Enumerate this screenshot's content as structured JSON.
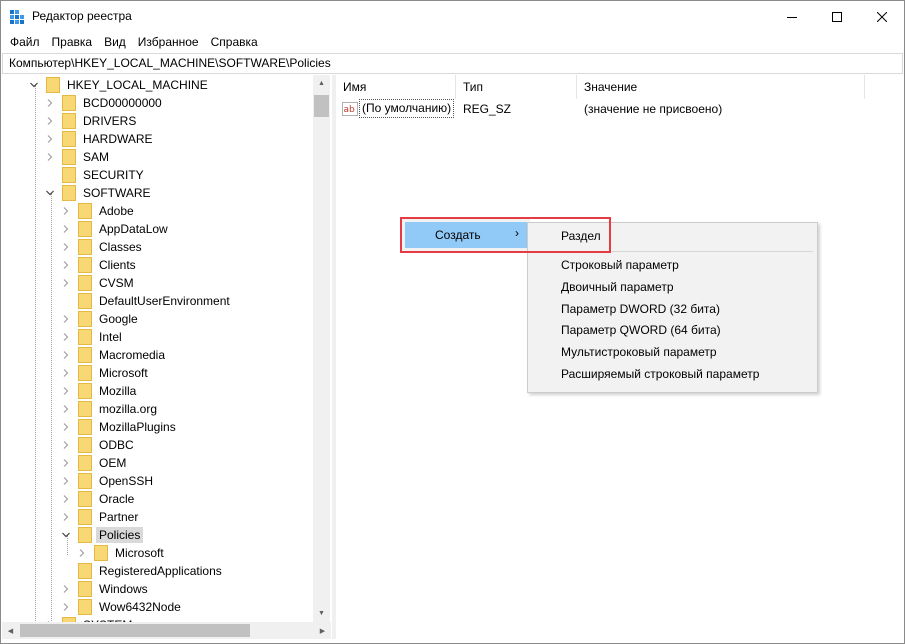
{
  "window": {
    "title": "Редактор реестра"
  },
  "menu": [
    "Файл",
    "Правка",
    "Вид",
    "Избранное",
    "Справка"
  ],
  "address": "Компьютер\\HKEY_LOCAL_MACHINE\\SOFTWARE\\Policies",
  "tree": [
    {
      "label": "HKEY_LOCAL_MACHINE",
      "expanded": true
    },
    {
      "label": "BCD00000000",
      "expandable": true
    },
    {
      "label": "DRIVERS",
      "expandable": true
    },
    {
      "label": "HARDWARE",
      "expandable": true
    },
    {
      "label": "SAM",
      "expandable": true
    },
    {
      "label": "SECURITY",
      "expandable": false
    },
    {
      "label": "SOFTWARE",
      "expanded": true
    },
    {
      "label": "Adobe",
      "expandable": true
    },
    {
      "label": "AppDataLow",
      "expandable": true
    },
    {
      "label": "Classes",
      "expandable": true
    },
    {
      "label": "Clients",
      "expandable": true
    },
    {
      "label": "CVSM",
      "expandable": true
    },
    {
      "label": "DefaultUserEnvironment",
      "expandable": false
    },
    {
      "label": "Google",
      "expandable": true
    },
    {
      "label": "Intel",
      "expandable": true
    },
    {
      "label": "Macromedia",
      "expandable": true
    },
    {
      "label": "Microsoft",
      "expandable": true
    },
    {
      "label": "Mozilla",
      "expandable": true
    },
    {
      "label": "mozilla.org",
      "expandable": true
    },
    {
      "label": "MozillaPlugins",
      "expandable": true
    },
    {
      "label": "ODBC",
      "expandable": true
    },
    {
      "label": "OEM",
      "expandable": true
    },
    {
      "label": "OpenSSH",
      "expandable": true
    },
    {
      "label": "Oracle",
      "expandable": true
    },
    {
      "label": "Partner",
      "expandable": true
    },
    {
      "label": "Policies",
      "expanded": true,
      "selected": true
    },
    {
      "label": "Microsoft",
      "expandable": true
    },
    {
      "label": "RegisteredApplications",
      "expandable": false
    },
    {
      "label": "Windows",
      "expandable": true
    },
    {
      "label": "Wow6432Node",
      "expandable": true
    },
    {
      "label": "SYSTEM",
      "expandable": true
    }
  ],
  "list": {
    "columns": [
      "Имя",
      "Тип",
      "Значение"
    ],
    "rows": [
      {
        "name": "(По умолчанию)",
        "type": "REG_SZ",
        "value": "(значение не присвоено)"
      }
    ]
  },
  "context_menu": {
    "main_item": "Создать",
    "submenu": [
      "Раздел",
      "Строковый параметр",
      "Двоичный параметр",
      "Параметр DWORD (32 бита)",
      "Параметр QWORD (64 бита)",
      "Мультистроковый параметр",
      "Расширяемый строковый параметр"
    ]
  },
  "colors": {
    "menu_highlight": "#91c9f7",
    "annotation_box": "#e53c43",
    "folder": "#f8d775"
  }
}
